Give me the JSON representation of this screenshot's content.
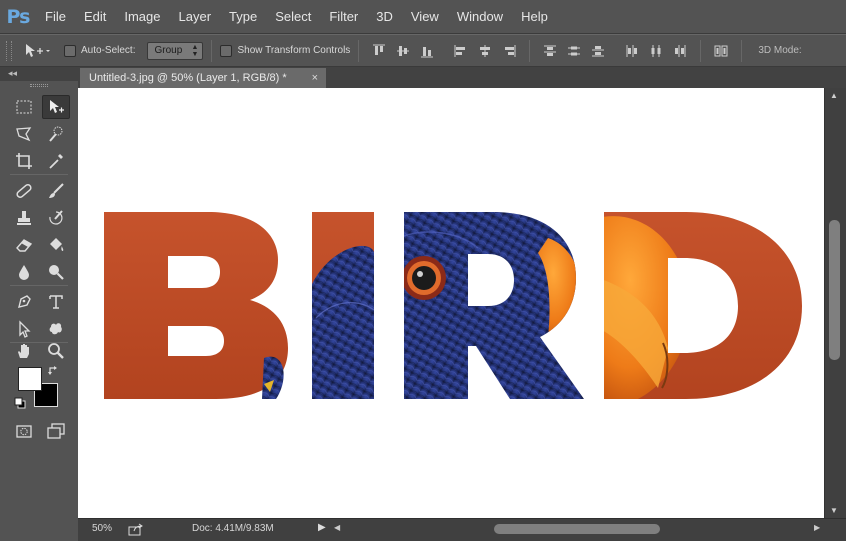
{
  "app": {
    "logo": "Ps"
  },
  "menu": [
    "File",
    "Edit",
    "Image",
    "Layer",
    "Type",
    "Select",
    "Filter",
    "3D",
    "View",
    "Window",
    "Help"
  ],
  "options": {
    "auto_select_label": "Auto-Select:",
    "auto_select_checked": false,
    "group_value": "Group",
    "show_transform_label": "Show Transform Controls",
    "show_transform_checked": false,
    "mode3d_label": "3D Mode:"
  },
  "toolbox": {
    "collapse_label": "◂◂"
  },
  "document": {
    "tab_title": "Untitled-3.jpg @ 50% (Layer 1, RGB/8) *",
    "close_glyph": "×",
    "canvas_text": "BIRD"
  },
  "colors": {
    "foreground": "#ffffff",
    "background": "#000000",
    "letter_orange": "#c0522a",
    "feather_blue": "#26377a",
    "beak_orange": "#f08a1c"
  },
  "status": {
    "zoom": "50%",
    "doc_info": "Doc: 4.41M/9.83M",
    "arrow": "▶"
  }
}
